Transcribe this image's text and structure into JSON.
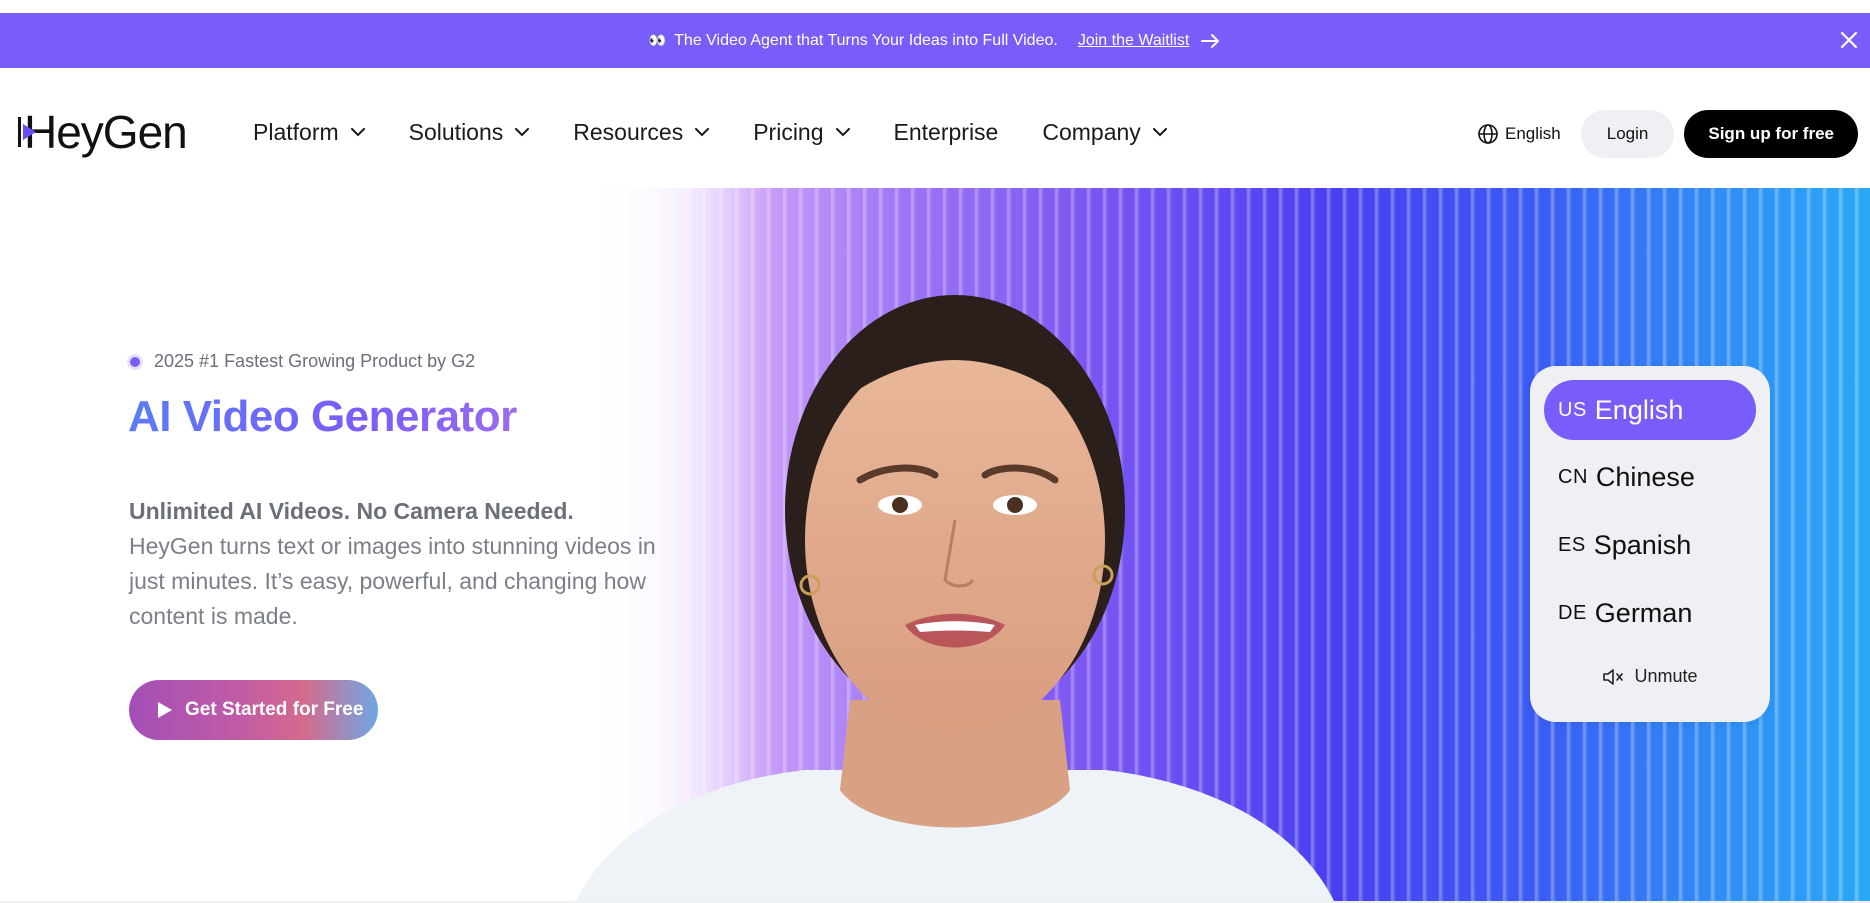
{
  "announcement": {
    "text": "The Video Agent that Turns Your Ideas into Full Video.",
    "link_label": "Join the Waitlist",
    "emoji": "👀"
  },
  "nav": {
    "logo": "HeyGen",
    "menu": [
      {
        "label": "Platform",
        "dropdown": true
      },
      {
        "label": "Solutions",
        "dropdown": true
      },
      {
        "label": "Resources",
        "dropdown": true
      },
      {
        "label": "Pricing",
        "dropdown": true
      },
      {
        "label": "Enterprise",
        "dropdown": false
      },
      {
        "label": "Company",
        "dropdown": true
      }
    ],
    "language": "English",
    "login": "Login",
    "signup": "Sign up for free"
  },
  "hero": {
    "badge": "2025 #1 Fastest Growing Product by G2",
    "title": "AI Video Generator",
    "subtitle_strong": "Unlimited AI Videos. No Camera Needed.",
    "subtitle": "HeyGen turns text or images into stunning videos in just minutes. It’s easy, powerful, and changing how content is made.",
    "cta": "Get Started for Free"
  },
  "language_panel": {
    "options": [
      {
        "code": "US",
        "label": "English",
        "active": true
      },
      {
        "code": "CN",
        "label": "Chinese",
        "active": false
      },
      {
        "code": "ES",
        "label": "Spanish",
        "active": false
      },
      {
        "code": "DE",
        "label": "German",
        "active": false
      }
    ],
    "unmute": "Unmute"
  },
  "colors": {
    "brand": "#7a5cfa",
    "signup_bg": "#000000",
    "login_bg": "#eef0f3"
  }
}
